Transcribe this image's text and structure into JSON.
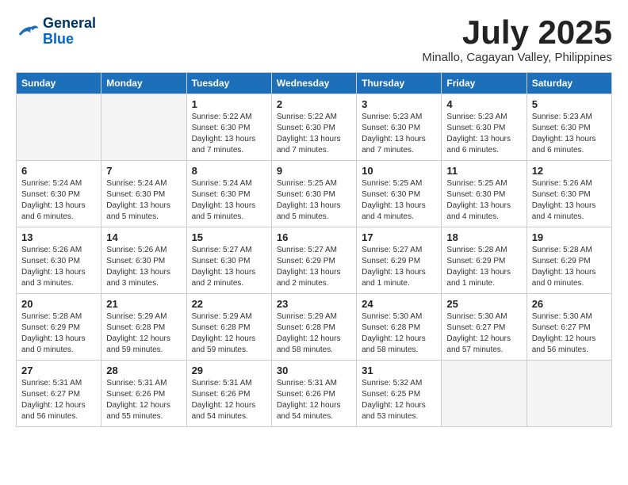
{
  "logo": {
    "line1": "General",
    "line2": "Blue"
  },
  "title": "July 2025",
  "subtitle": "Minallo, Cagayan Valley, Philippines",
  "headers": [
    "Sunday",
    "Monday",
    "Tuesday",
    "Wednesday",
    "Thursday",
    "Friday",
    "Saturday"
  ],
  "weeks": [
    [
      {
        "day": "",
        "info": ""
      },
      {
        "day": "",
        "info": ""
      },
      {
        "day": "1",
        "info": "Sunrise: 5:22 AM\nSunset: 6:30 PM\nDaylight: 13 hours and 7 minutes."
      },
      {
        "day": "2",
        "info": "Sunrise: 5:22 AM\nSunset: 6:30 PM\nDaylight: 13 hours and 7 minutes."
      },
      {
        "day": "3",
        "info": "Sunrise: 5:23 AM\nSunset: 6:30 PM\nDaylight: 13 hours and 7 minutes."
      },
      {
        "day": "4",
        "info": "Sunrise: 5:23 AM\nSunset: 6:30 PM\nDaylight: 13 hours and 6 minutes."
      },
      {
        "day": "5",
        "info": "Sunrise: 5:23 AM\nSunset: 6:30 PM\nDaylight: 13 hours and 6 minutes."
      }
    ],
    [
      {
        "day": "6",
        "info": "Sunrise: 5:24 AM\nSunset: 6:30 PM\nDaylight: 13 hours and 6 minutes."
      },
      {
        "day": "7",
        "info": "Sunrise: 5:24 AM\nSunset: 6:30 PM\nDaylight: 13 hours and 5 minutes."
      },
      {
        "day": "8",
        "info": "Sunrise: 5:24 AM\nSunset: 6:30 PM\nDaylight: 13 hours and 5 minutes."
      },
      {
        "day": "9",
        "info": "Sunrise: 5:25 AM\nSunset: 6:30 PM\nDaylight: 13 hours and 5 minutes."
      },
      {
        "day": "10",
        "info": "Sunrise: 5:25 AM\nSunset: 6:30 PM\nDaylight: 13 hours and 4 minutes."
      },
      {
        "day": "11",
        "info": "Sunrise: 5:25 AM\nSunset: 6:30 PM\nDaylight: 13 hours and 4 minutes."
      },
      {
        "day": "12",
        "info": "Sunrise: 5:26 AM\nSunset: 6:30 PM\nDaylight: 13 hours and 4 minutes."
      }
    ],
    [
      {
        "day": "13",
        "info": "Sunrise: 5:26 AM\nSunset: 6:30 PM\nDaylight: 13 hours and 3 minutes."
      },
      {
        "day": "14",
        "info": "Sunrise: 5:26 AM\nSunset: 6:30 PM\nDaylight: 13 hours and 3 minutes."
      },
      {
        "day": "15",
        "info": "Sunrise: 5:27 AM\nSunset: 6:30 PM\nDaylight: 13 hours and 2 minutes."
      },
      {
        "day": "16",
        "info": "Sunrise: 5:27 AM\nSunset: 6:29 PM\nDaylight: 13 hours and 2 minutes."
      },
      {
        "day": "17",
        "info": "Sunrise: 5:27 AM\nSunset: 6:29 PM\nDaylight: 13 hours and 1 minute."
      },
      {
        "day": "18",
        "info": "Sunrise: 5:28 AM\nSunset: 6:29 PM\nDaylight: 13 hours and 1 minute."
      },
      {
        "day": "19",
        "info": "Sunrise: 5:28 AM\nSunset: 6:29 PM\nDaylight: 13 hours and 0 minutes."
      }
    ],
    [
      {
        "day": "20",
        "info": "Sunrise: 5:28 AM\nSunset: 6:29 PM\nDaylight: 13 hours and 0 minutes."
      },
      {
        "day": "21",
        "info": "Sunrise: 5:29 AM\nSunset: 6:28 PM\nDaylight: 12 hours and 59 minutes."
      },
      {
        "day": "22",
        "info": "Sunrise: 5:29 AM\nSunset: 6:28 PM\nDaylight: 12 hours and 59 minutes."
      },
      {
        "day": "23",
        "info": "Sunrise: 5:29 AM\nSunset: 6:28 PM\nDaylight: 12 hours and 58 minutes."
      },
      {
        "day": "24",
        "info": "Sunrise: 5:30 AM\nSunset: 6:28 PM\nDaylight: 12 hours and 58 minutes."
      },
      {
        "day": "25",
        "info": "Sunrise: 5:30 AM\nSunset: 6:27 PM\nDaylight: 12 hours and 57 minutes."
      },
      {
        "day": "26",
        "info": "Sunrise: 5:30 AM\nSunset: 6:27 PM\nDaylight: 12 hours and 56 minutes."
      }
    ],
    [
      {
        "day": "27",
        "info": "Sunrise: 5:31 AM\nSunset: 6:27 PM\nDaylight: 12 hours and 56 minutes."
      },
      {
        "day": "28",
        "info": "Sunrise: 5:31 AM\nSunset: 6:26 PM\nDaylight: 12 hours and 55 minutes."
      },
      {
        "day": "29",
        "info": "Sunrise: 5:31 AM\nSunset: 6:26 PM\nDaylight: 12 hours and 54 minutes."
      },
      {
        "day": "30",
        "info": "Sunrise: 5:31 AM\nSunset: 6:26 PM\nDaylight: 12 hours and 54 minutes."
      },
      {
        "day": "31",
        "info": "Sunrise: 5:32 AM\nSunset: 6:25 PM\nDaylight: 12 hours and 53 minutes."
      },
      {
        "day": "",
        "info": ""
      },
      {
        "day": "",
        "info": ""
      }
    ]
  ]
}
